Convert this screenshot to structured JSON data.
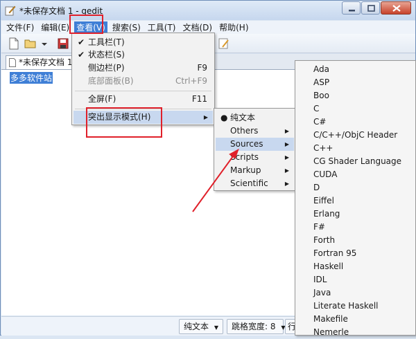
{
  "window": {
    "title": "*未保存文档 1 - gedit",
    "controls": [
      "minimize",
      "maximize",
      "close"
    ]
  },
  "menubar": {
    "items": [
      {
        "label": "文件(F)"
      },
      {
        "label": "编辑(E)"
      },
      {
        "label": "查看(V)"
      },
      {
        "label": "搜索(S)"
      },
      {
        "label": "工具(T)"
      },
      {
        "label": "文档(D)"
      },
      {
        "label": "帮助(H)"
      }
    ]
  },
  "toolbar": {
    "buttons": [
      "new-document-icon",
      "open-folder-icon",
      "dropdown-arrow-icon",
      "save-icon",
      "spellcheck-icon"
    ]
  },
  "tab": {
    "label": "*未保存文档 1"
  },
  "editor": {
    "selected_text": "多多软件站"
  },
  "view_menu": {
    "items": [
      {
        "label": "工具栏(T)",
        "checked": true,
        "accel": ""
      },
      {
        "label": "状态栏(S)",
        "checked": true,
        "accel": ""
      },
      {
        "label": "侧边栏(P)",
        "checked": false,
        "accel": "F9"
      },
      {
        "label": "底部面板(B)",
        "checked": false,
        "accel": "Ctrl+F9",
        "disabled": true
      },
      {
        "label": "全屏(F)",
        "checked": false,
        "accel": "F11"
      },
      {
        "label": "突出显示模式(H)",
        "submenu": true,
        "highlighted": true
      }
    ]
  },
  "highlight_menu": {
    "items": [
      {
        "label": "纯文本",
        "radio": true
      },
      {
        "label": "Others",
        "submenu": true
      },
      {
        "label": "Sources",
        "submenu": true,
        "highlighted": true
      },
      {
        "label": "Scripts",
        "submenu": true
      },
      {
        "label": "Markup",
        "submenu": true
      },
      {
        "label": "Scientific",
        "submenu": true
      }
    ]
  },
  "sources_menu": {
    "items": [
      "Ada",
      "ASP",
      "Boo",
      "C",
      "C#",
      "C/C++/ObjC Header",
      "C++",
      "CG Shader Language",
      "CUDA",
      "D",
      "Eiffel",
      "Erlang",
      "F#",
      "Forth",
      "Fortran 95",
      "Haskell",
      "IDL",
      "Java",
      "Literate Haskell",
      "Makefile",
      "Nemerle"
    ]
  },
  "statusbar": {
    "language": "纯文本",
    "tab_width": "跳格宽度: 8",
    "position": "行"
  },
  "colors": {
    "accent": "#3f7fd6",
    "annotation": "#e0202a"
  }
}
